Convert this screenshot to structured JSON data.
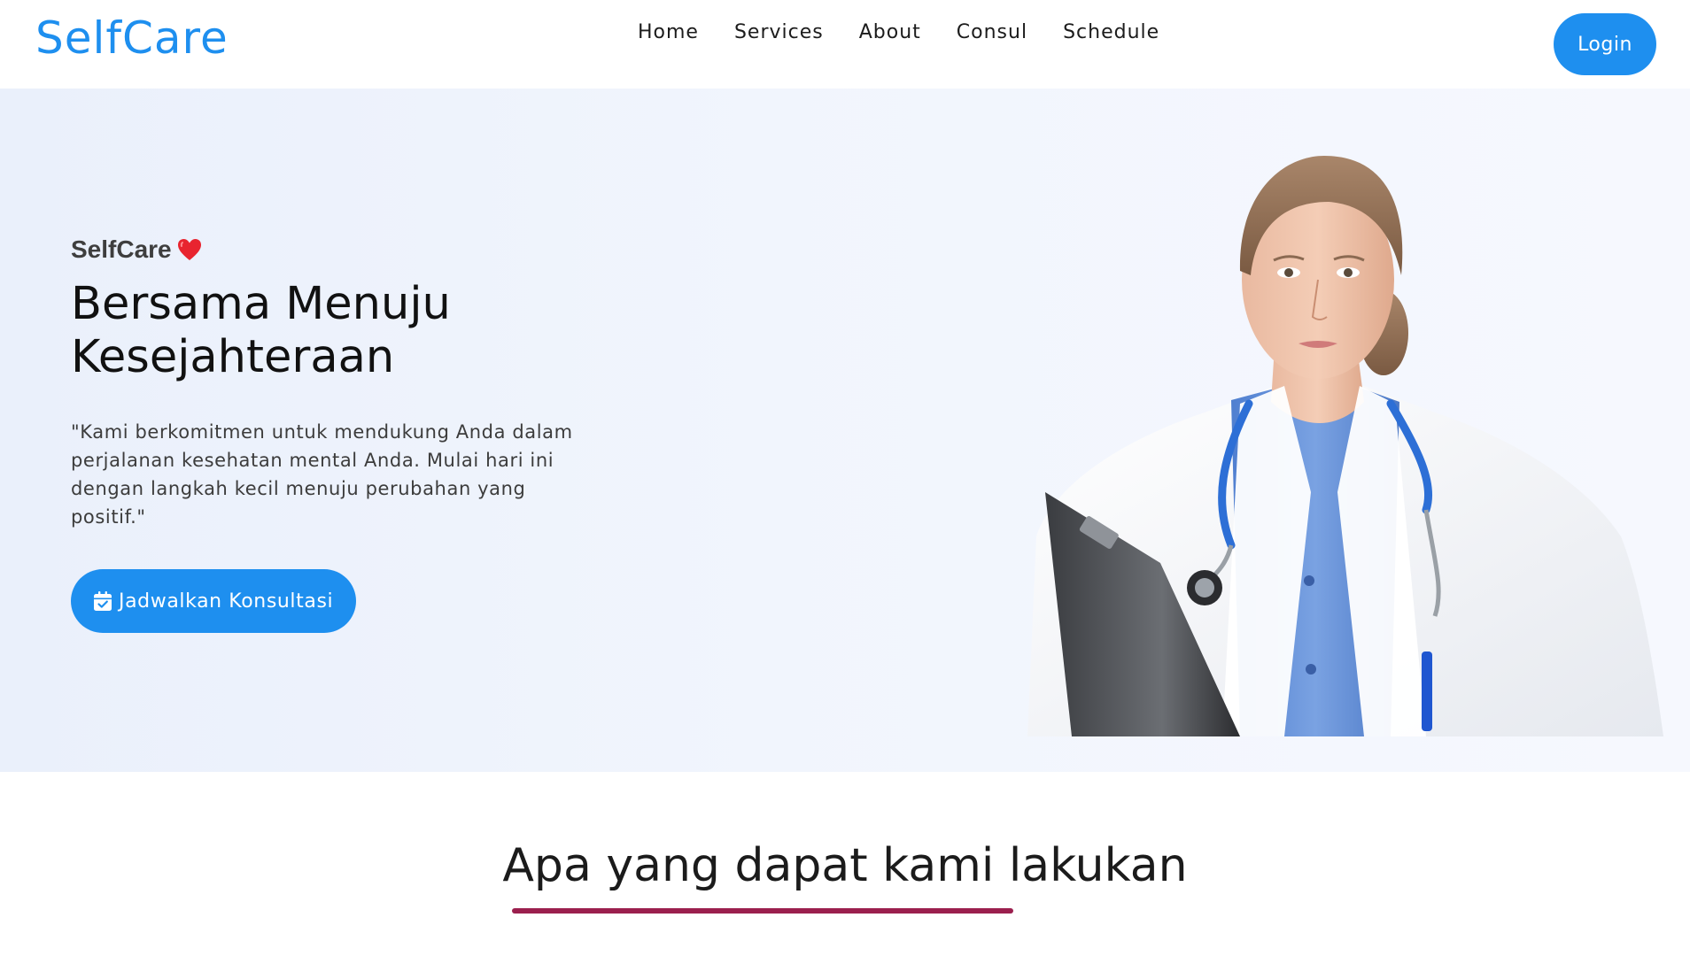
{
  "navbar": {
    "brand": "SelfCare",
    "links": [
      "Home",
      "Services",
      "About",
      "Consul",
      "Schedule"
    ],
    "login_label": "Login"
  },
  "hero": {
    "kicker": "SelfCare",
    "title_line1": "Bersama Menuju",
    "title_line2": "Kesejahteraan",
    "description": "\"Kami berkomitmen untuk mendukung Anda dalam perjalanan kesehatan mental Anda. Mulai hari ini dengan langkah kecil menuju perubahan yang positif.\"",
    "cta_label": "Jadwalkan Konsultasi"
  },
  "section": {
    "title": "Apa yang dapat kami lakukan"
  },
  "icons": {
    "kicker": "heart-icon",
    "cta": "calendar-icon"
  },
  "colors": {
    "primary": "#1e8fef",
    "accent_underline": "#9b1f4e",
    "hero_bg": "#eef3fc"
  }
}
